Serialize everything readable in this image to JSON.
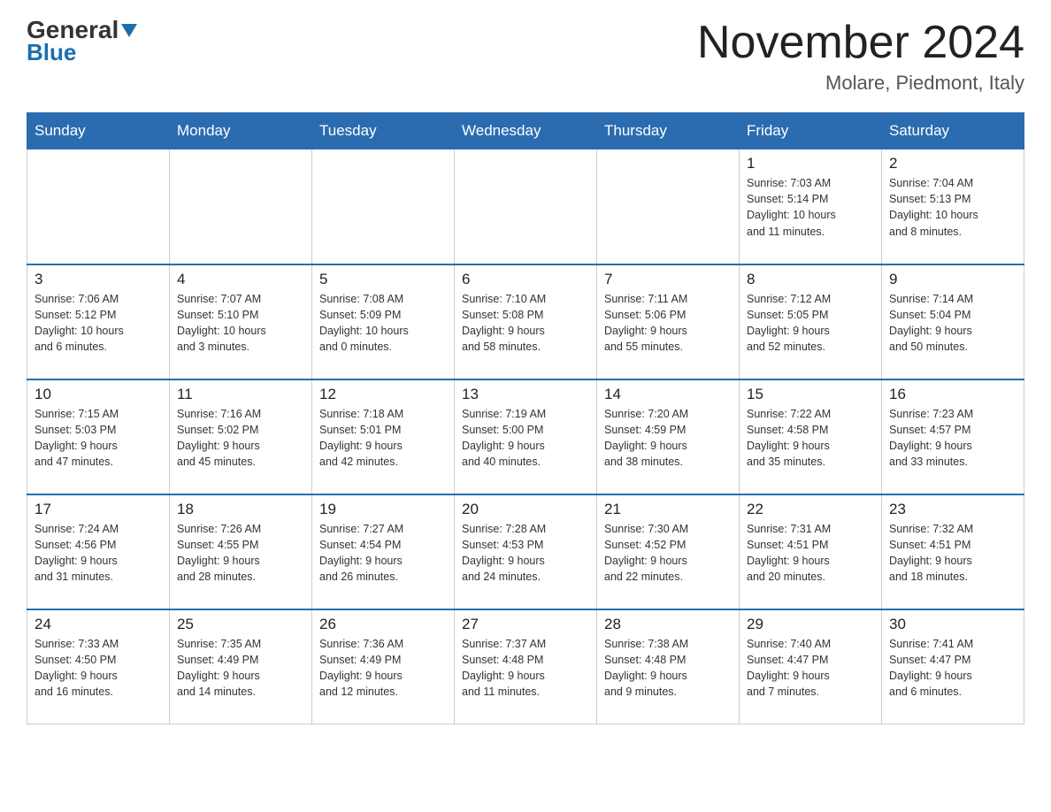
{
  "header": {
    "logo": {
      "line1": "General",
      "line2": "Blue"
    },
    "title": "November 2024",
    "location": "Molare, Piedmont, Italy"
  },
  "days_of_week": [
    "Sunday",
    "Monday",
    "Tuesday",
    "Wednesday",
    "Thursday",
    "Friday",
    "Saturday"
  ],
  "weeks": [
    [
      {
        "day": "",
        "info": ""
      },
      {
        "day": "",
        "info": ""
      },
      {
        "day": "",
        "info": ""
      },
      {
        "day": "",
        "info": ""
      },
      {
        "day": "",
        "info": ""
      },
      {
        "day": "1",
        "info": "Sunrise: 7:03 AM\nSunset: 5:14 PM\nDaylight: 10 hours\nand 11 minutes."
      },
      {
        "day": "2",
        "info": "Sunrise: 7:04 AM\nSunset: 5:13 PM\nDaylight: 10 hours\nand 8 minutes."
      }
    ],
    [
      {
        "day": "3",
        "info": "Sunrise: 7:06 AM\nSunset: 5:12 PM\nDaylight: 10 hours\nand 6 minutes."
      },
      {
        "day": "4",
        "info": "Sunrise: 7:07 AM\nSunset: 5:10 PM\nDaylight: 10 hours\nand 3 minutes."
      },
      {
        "day": "5",
        "info": "Sunrise: 7:08 AM\nSunset: 5:09 PM\nDaylight: 10 hours\nand 0 minutes."
      },
      {
        "day": "6",
        "info": "Sunrise: 7:10 AM\nSunset: 5:08 PM\nDaylight: 9 hours\nand 58 minutes."
      },
      {
        "day": "7",
        "info": "Sunrise: 7:11 AM\nSunset: 5:06 PM\nDaylight: 9 hours\nand 55 minutes."
      },
      {
        "day": "8",
        "info": "Sunrise: 7:12 AM\nSunset: 5:05 PM\nDaylight: 9 hours\nand 52 minutes."
      },
      {
        "day": "9",
        "info": "Sunrise: 7:14 AM\nSunset: 5:04 PM\nDaylight: 9 hours\nand 50 minutes."
      }
    ],
    [
      {
        "day": "10",
        "info": "Sunrise: 7:15 AM\nSunset: 5:03 PM\nDaylight: 9 hours\nand 47 minutes."
      },
      {
        "day": "11",
        "info": "Sunrise: 7:16 AM\nSunset: 5:02 PM\nDaylight: 9 hours\nand 45 minutes."
      },
      {
        "day": "12",
        "info": "Sunrise: 7:18 AM\nSunset: 5:01 PM\nDaylight: 9 hours\nand 42 minutes."
      },
      {
        "day": "13",
        "info": "Sunrise: 7:19 AM\nSunset: 5:00 PM\nDaylight: 9 hours\nand 40 minutes."
      },
      {
        "day": "14",
        "info": "Sunrise: 7:20 AM\nSunset: 4:59 PM\nDaylight: 9 hours\nand 38 minutes."
      },
      {
        "day": "15",
        "info": "Sunrise: 7:22 AM\nSunset: 4:58 PM\nDaylight: 9 hours\nand 35 minutes."
      },
      {
        "day": "16",
        "info": "Sunrise: 7:23 AM\nSunset: 4:57 PM\nDaylight: 9 hours\nand 33 minutes."
      }
    ],
    [
      {
        "day": "17",
        "info": "Sunrise: 7:24 AM\nSunset: 4:56 PM\nDaylight: 9 hours\nand 31 minutes."
      },
      {
        "day": "18",
        "info": "Sunrise: 7:26 AM\nSunset: 4:55 PM\nDaylight: 9 hours\nand 28 minutes."
      },
      {
        "day": "19",
        "info": "Sunrise: 7:27 AM\nSunset: 4:54 PM\nDaylight: 9 hours\nand 26 minutes."
      },
      {
        "day": "20",
        "info": "Sunrise: 7:28 AM\nSunset: 4:53 PM\nDaylight: 9 hours\nand 24 minutes."
      },
      {
        "day": "21",
        "info": "Sunrise: 7:30 AM\nSunset: 4:52 PM\nDaylight: 9 hours\nand 22 minutes."
      },
      {
        "day": "22",
        "info": "Sunrise: 7:31 AM\nSunset: 4:51 PM\nDaylight: 9 hours\nand 20 minutes."
      },
      {
        "day": "23",
        "info": "Sunrise: 7:32 AM\nSunset: 4:51 PM\nDaylight: 9 hours\nand 18 minutes."
      }
    ],
    [
      {
        "day": "24",
        "info": "Sunrise: 7:33 AM\nSunset: 4:50 PM\nDaylight: 9 hours\nand 16 minutes."
      },
      {
        "day": "25",
        "info": "Sunrise: 7:35 AM\nSunset: 4:49 PM\nDaylight: 9 hours\nand 14 minutes."
      },
      {
        "day": "26",
        "info": "Sunrise: 7:36 AM\nSunset: 4:49 PM\nDaylight: 9 hours\nand 12 minutes."
      },
      {
        "day": "27",
        "info": "Sunrise: 7:37 AM\nSunset: 4:48 PM\nDaylight: 9 hours\nand 11 minutes."
      },
      {
        "day": "28",
        "info": "Sunrise: 7:38 AM\nSunset: 4:48 PM\nDaylight: 9 hours\nand 9 minutes."
      },
      {
        "day": "29",
        "info": "Sunrise: 7:40 AM\nSunset: 4:47 PM\nDaylight: 9 hours\nand 7 minutes."
      },
      {
        "day": "30",
        "info": "Sunrise: 7:41 AM\nSunset: 4:47 PM\nDaylight: 9 hours\nand 6 minutes."
      }
    ]
  ]
}
